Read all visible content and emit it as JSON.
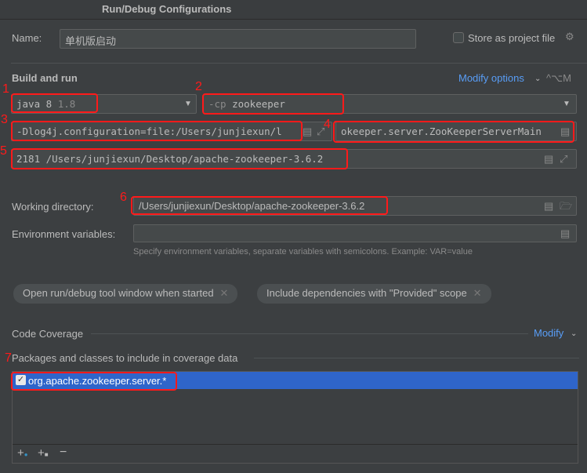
{
  "window": {
    "title": "Run/Debug Configurations"
  },
  "name": {
    "label": "Name:",
    "value": "单机版启动"
  },
  "store_project": {
    "label": "Store as project file",
    "checked": false
  },
  "build_run": {
    "heading": "Build and run",
    "modify_options": "Modify options",
    "shortcut": "^⌥M",
    "jre": {
      "value": "java 8",
      "version": "1.8"
    },
    "classpath": {
      "prefix": "-cp",
      "value": "zookeeper"
    },
    "vm_options": "-Dlog4j.configuration=file:/Users/junjiexun/l",
    "main_class": "okeeper.server.ZooKeeperServerMain",
    "program_args": "2181 /Users/junjiexun/Desktop/apache-zookeeper-3.6.2"
  },
  "working_dir": {
    "label": "Working directory:",
    "value": "/Users/junjiexun/Desktop/apache-zookeeper-3.6.2"
  },
  "env_vars": {
    "label": "Environment variables:",
    "value": "",
    "hint": "Specify environment variables, separate variables with semicolons. Example: VAR=value"
  },
  "chips": [
    {
      "label": "Open run/debug tool window when started"
    },
    {
      "label": "Include dependencies with \"Provided\" scope"
    }
  ],
  "coverage": {
    "heading": "Code Coverage",
    "modify": "Modify",
    "packages_heading": "Packages and classes to include in coverage data",
    "items": [
      {
        "label": "org.apache.zookeeper.server.*",
        "checked": true
      }
    ]
  },
  "annotations": [
    "1",
    "2",
    "3",
    "4",
    "5",
    "6",
    "7"
  ],
  "colors": {
    "accent": "#589df6",
    "selection": "#2f65ca",
    "annotation": "#ff1a1a"
  }
}
